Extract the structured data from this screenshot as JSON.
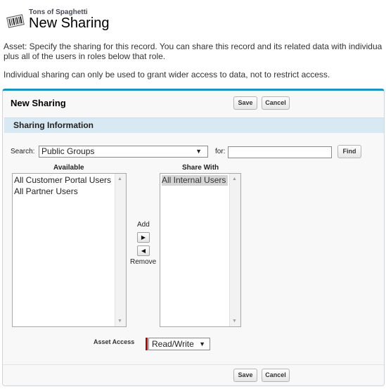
{
  "header": {
    "record_name": "Tons of Spaghetti",
    "title": "New Sharing",
    "icon": "asset-barcode-icon"
  },
  "help": {
    "line1": "Asset: Specify the sharing for this record. You can share this record and its related data with individua",
    "line2": "plus all of the users in roles below that role.",
    "line3": "Individual sharing can only be used to grant wider access to data, not to restrict access."
  },
  "panel": {
    "title": "New Sharing",
    "save_label": "Save",
    "cancel_label": "Cancel"
  },
  "section": {
    "title": "Sharing Information"
  },
  "search": {
    "label": "Search:",
    "selected": "Public Groups",
    "for_label": "for:",
    "for_value": "",
    "find_label": "Find"
  },
  "available": {
    "header": "Available",
    "items": [
      "All Customer Portal Users",
      "All Partner Users"
    ]
  },
  "share_with": {
    "header": "Share With",
    "items": [
      "All Internal Users"
    ]
  },
  "transfer": {
    "add_label": "Add",
    "remove_label": "Remove"
  },
  "access": {
    "label": "Asset Access",
    "selected": "Read/Write"
  },
  "colors": {
    "panel_accent": "#1797c0",
    "section_bg": "#d8e9f3",
    "required_marker": "#cc0000"
  }
}
